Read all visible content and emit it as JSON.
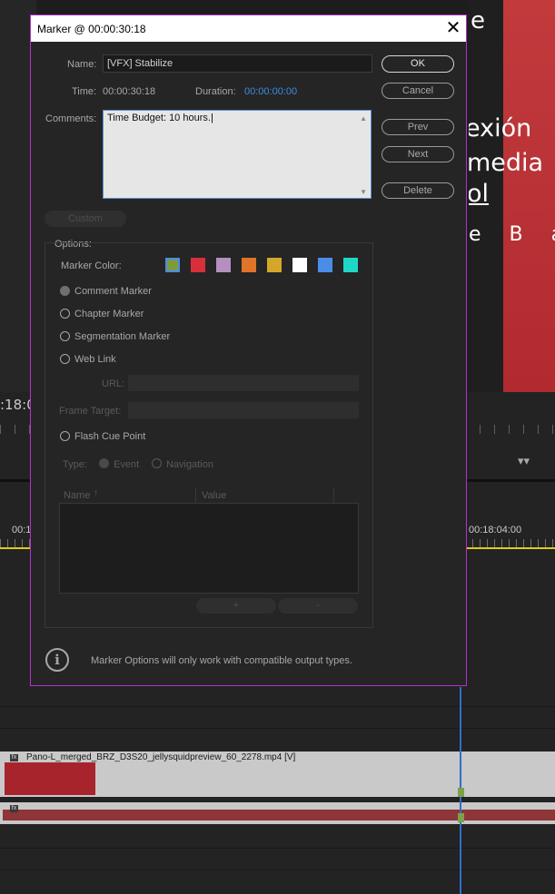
{
  "background": {
    "timecode_big": ":18:0",
    "ruler_left": "00:1",
    "ruler_right": "00:18:04:00",
    "clip_name": "Pano-L_merged_BRZ_D3S20_jellysquidpreview_60_2278.mp4 [V]",
    "fx_label": "fx",
    "video_text_lines": [
      "e",
      "exión",
      "media",
      "ol",
      "e B a"
    ]
  },
  "dialog": {
    "title": "Marker @ 00:00:30:18",
    "name_label": "Name:",
    "name_value": "[VFX] Stabilize",
    "time_label": "Time:",
    "time_value": "00:00:30:18",
    "duration_label": "Duration:",
    "duration_value": "00:00:00:00",
    "comments_label": "Comments:",
    "comments_value": "Time Budget: 10 hours.",
    "buttons": {
      "ok": "OK",
      "cancel": "Cancel",
      "prev": "Prev",
      "next": "Next",
      "delete": "Delete",
      "custom": "Custom",
      "add": "+",
      "remove": "-"
    },
    "options_label": "Options:",
    "marker_color_label": "Marker Color:",
    "marker_colors": [
      "#7d9a3c",
      "#d8303a",
      "#b58fbf",
      "#e07428",
      "#d4a72a",
      "#ffffff",
      "#4a8de8",
      "#1ed8c6"
    ],
    "selected_color": "#7d9a3c",
    "marker_types": {
      "comment": "Comment Marker",
      "chapter": "Chapter Marker",
      "segmentation": "Segmentation Marker",
      "web_link": "Web Link",
      "flash_cue": "Flash Cue Point"
    },
    "selected_marker_type": "Comment Marker",
    "url_label": "URL:",
    "frame_target_label": "Frame Target:",
    "type_label": "Type:",
    "type_event": "Event",
    "type_navigation": "Navigation",
    "table_headers": {
      "name": "Name",
      "value": "Value"
    },
    "info_text": "Marker Options will only work with compatible output types."
  }
}
